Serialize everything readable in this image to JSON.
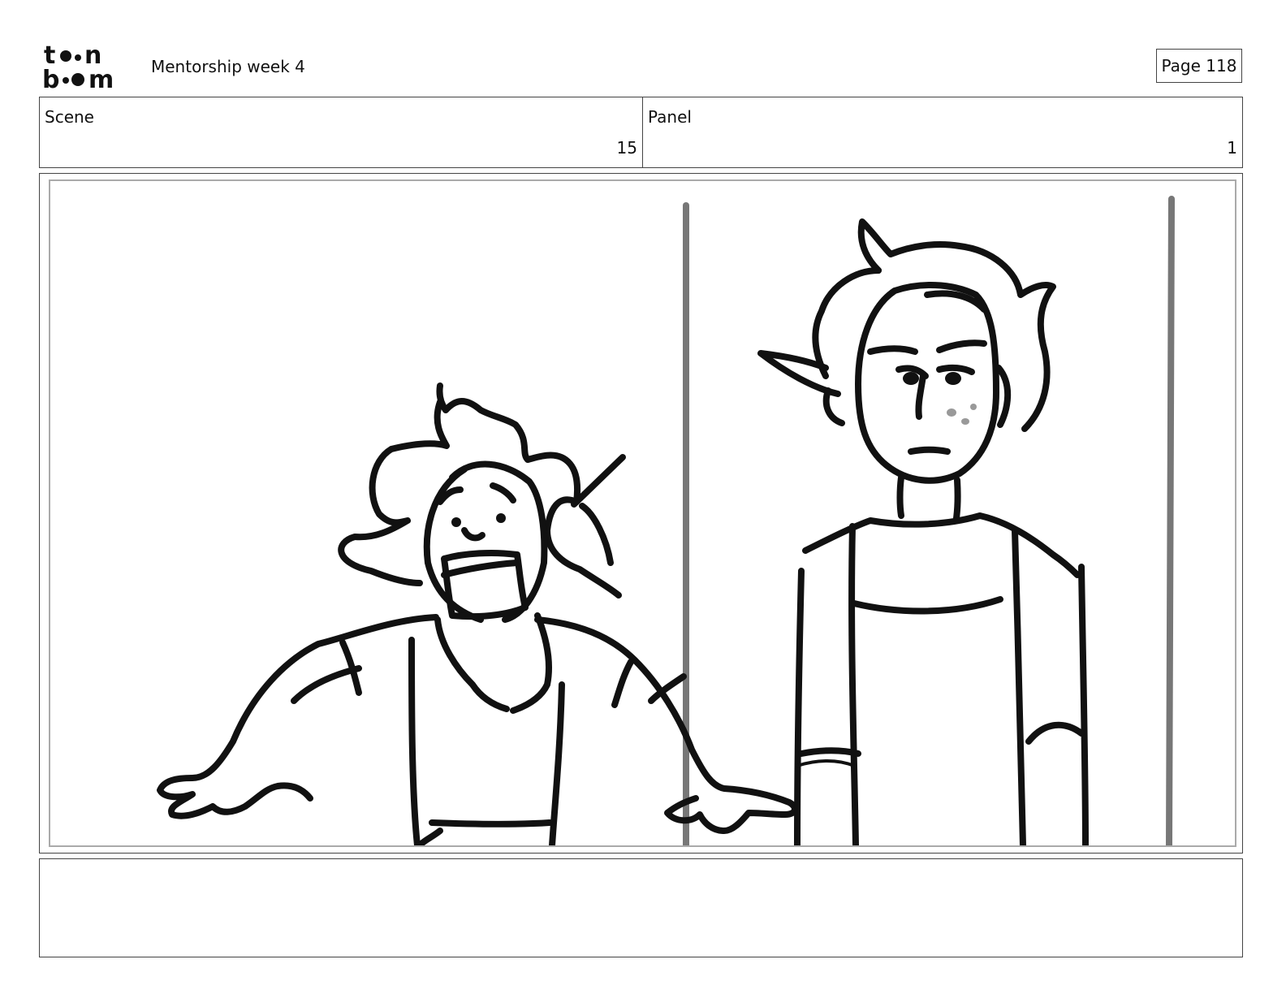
{
  "header": {
    "logo_text_top": "toon",
    "logo_text_bottom": "boom",
    "title": "Mentorship week 4",
    "page_label": "Page 118"
  },
  "info": {
    "scene_label": "Scene",
    "scene_value": "15",
    "panel_label": "Panel",
    "panel_value": "1"
  },
  "notes": {
    "text": ""
  },
  "colors": {
    "ink": "#111111",
    "frame": "#444444",
    "inner_frame": "#aaaaaa",
    "pole": "#777777"
  }
}
